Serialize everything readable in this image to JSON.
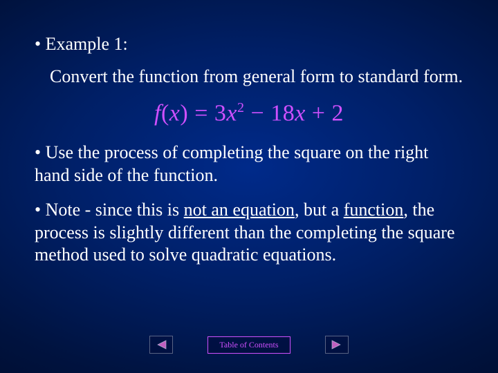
{
  "slide": {
    "bullet1": "•  Example 1:",
    "sub1": "Convert the function from general form to standard form.",
    "equation": {
      "lhs_f": "f",
      "lhs_open": "(",
      "lhs_var": "x",
      "lhs_close": ")",
      "eq": " = ",
      "term1_coef": "3",
      "term1_var": "x",
      "term1_exp": "2",
      "minus": " − ",
      "term2_coef": "18",
      "term2_var": "x",
      "plus": " + ",
      "term3": "2"
    },
    "bullet2_a": "•  Use the process of completing the square on the right hand side of the function.",
    "bullet3": {
      "pre": "•  Note - since this is ",
      "u1": "not an equation",
      "mid": ", but a ",
      "u2": "function",
      "post": ", the process is slightly different than the completing the square method used to solve quadratic equations."
    }
  },
  "nav": {
    "toc": "Table of Contents"
  }
}
